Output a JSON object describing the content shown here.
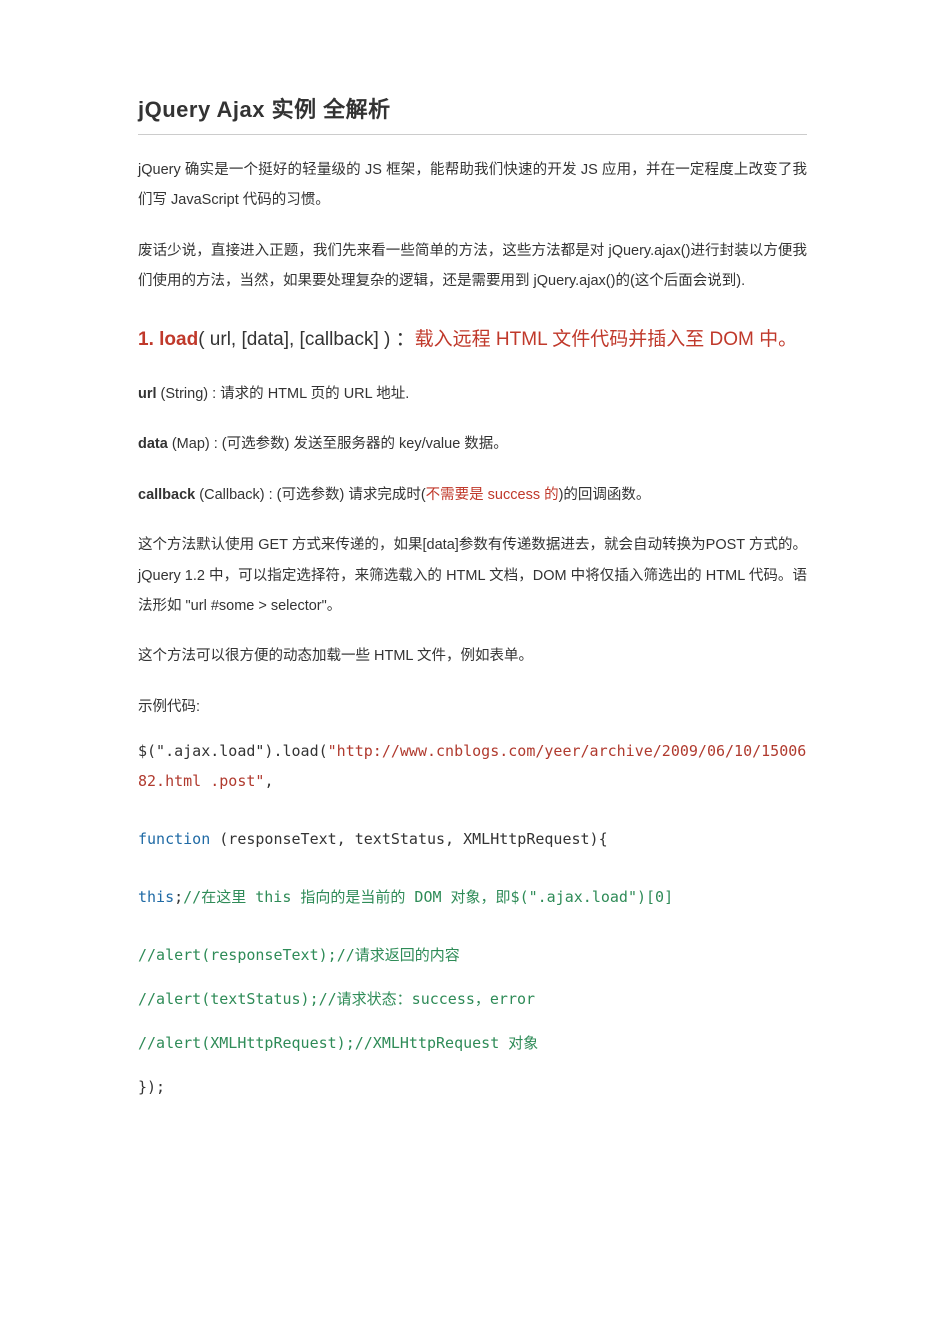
{
  "title": "jQuery Ajax 实例 全解析",
  "intro1": "jQuery 确实是一个挺好的轻量级的 JS 框架，能帮助我们快速的开发 JS 应用，并在一定程度上改变了我们写 JavaScript 代码的习惯。",
  "intro2": "废话少说，直接进入正题，我们先来看一些简单的方法，这些方法都是对 jQuery.ajax()进行封装以方便我们使用的方法，当然，如果要处理复杂的逻辑，还是需要用到 jQuery.ajax()的(这个后面会说到).",
  "heading": {
    "num": "1. ",
    "fn": "load",
    "sig": "( url, [data], [callback] )  ：",
    "desc": "载入远程 HTML 文件代码并插入至 DOM 中。"
  },
  "param_url_label": "url",
  "param_url_text": " (String) : 请求的 HTML 页的 URL 地址.",
  "param_data_label": "data",
  "param_data_text": " (Map) : (可选参数) 发送至服务器的 key/value 数据。",
  "param_cb_label": "callback",
  "param_cb_text_a": " (Callback) : (可选参数) 请求完成时(",
  "param_cb_highlight": "不需要是 success 的",
  "param_cb_text_b": ")的回调函数。",
  "desc_p1": "这个方法默认使用 GET 方式来传递的，如果[data]参数有传递数据进去，就会自动转换为POST 方式的。jQuery 1.2 中，可以指定选择符，来筛选载入的 HTML 文档，DOM 中将仅插入筛选出的 HTML 代码。语法形如 \"url #some > selector\"。",
  "desc_p2": "这个方法可以很方便的动态加载一些 HTML 文件，例如表单。",
  "example_label": "示例代码:",
  "code": {
    "line1a": "$(\".ajax.load\").load(",
    "line1b": "\"http://www.cnblogs.com/yeer/archive/2009/06/10/1500682.html .post\"",
    "line1c": ",",
    "line2a": "function ",
    "line2b": "(responseText, textStatus, XMLHttpRequest){",
    "line3a": "this",
    "line3b": ";",
    "line3c": "//在这里 this 指向的是当前的 DOM 对象，即$(\".ajax.load\")[0]",
    "line4a": "//alert(responseText);",
    "line4b": "//请求返回的内容",
    "line5a": "//alert(textStatus);",
    "line5b": "//请求状态：success，error",
    "line6a": "//alert(XMLHttpRequest);",
    "line6b": "//XMLHttpRequest 对象",
    "line7": "});"
  }
}
